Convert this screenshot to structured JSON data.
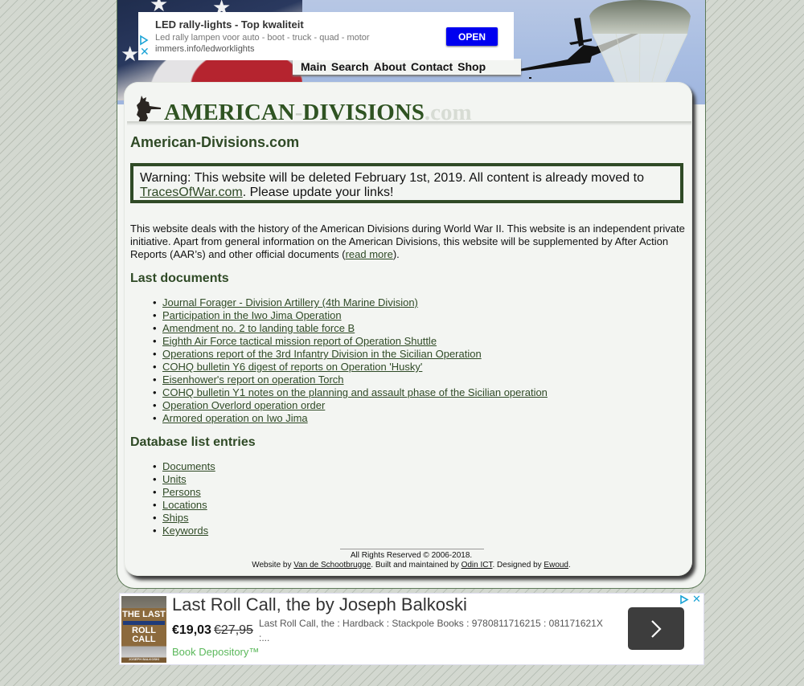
{
  "top_ad": {
    "title": "LED rally-lights - Top kwaliteit",
    "description": "Led rally lampen voor auto - boot - truck - quad - motor",
    "url": "immers.info/ledworklights",
    "button_label": "OPEN",
    "close_glyph": "✕",
    "button_color": "#0000f0"
  },
  "nav": {
    "items": [
      "Main",
      "Search",
      "About",
      "Contact",
      "Shop"
    ]
  },
  "logo": {
    "main": "AMERICAN",
    "dash": "-",
    "second": "DIVISIONS",
    "tld": ".com"
  },
  "site_title": "American-Divisions.com",
  "warning": {
    "text_before": "Warning: This website will be deleted February 1st, 2019. All content is already moved to ",
    "link": "TracesOfWar.com",
    "text_after": ". Please update your links!"
  },
  "intro": {
    "text": "This website deals with the history of the American Divisions during World War II. This website is an independent private initiative. Apart from general information on the American Divisions, this website will be supplemented by After Action Reports (AAR’s) and other official documents (",
    "link": "read more",
    "text_after": ")."
  },
  "last_documents": {
    "heading": "Last documents",
    "items": [
      "Journal Forager - Division Artillery (4th Marine Division)",
      "Participation in the Iwo Jima Operation",
      "Amendment no. 2 to landing table force B",
      "Eighth Air Force tactical mission report of Operation Shuttle",
      "Operations report of the 3rd Infantry Division in the Sicilian Operation",
      "COHQ bulletin Y6 digest of reports on Operation 'Husky'",
      "Eisenhower's report on operation Torch",
      "COHQ bulletin Y1 notes on the planning and assault phase of the Sicilian operation",
      "Operation Overlord operation order",
      "Armored operation on Iwo Jima"
    ]
  },
  "database": {
    "heading": "Database list entries",
    "items": [
      "Documents",
      "Units",
      "Persons",
      "Locations",
      "Ships",
      "Keywords"
    ]
  },
  "footer": {
    "rights": "All Rights Reserved © 2006-2018.",
    "website_by": "Website by ",
    "website_by_link": "Van de Schootbrugge",
    "built_by": ". Built and maintained by ",
    "built_by_link": "Odin ICT",
    "designed_by": ". Designed by ",
    "designed_by_link": "Ewoud",
    "end": "."
  },
  "bottom_ad": {
    "headline": "Last Roll Call, the by Joseph Balkoski",
    "price": "€19,03",
    "old_price": "€27,95",
    "description": "Last Roll Call, the : Hardback : Stackpole Books : 9780811716215 : 081171621X :...",
    "seller": "Book Depository™",
    "cover_line1": "THE LAST",
    "cover_line2": "ROLL CALL",
    "cover_author": "JOSEPH BALKOSKI",
    "close_glyph": "✕"
  },
  "colors": {
    "brand_green": "#2f4a26",
    "logo_green": "#2f5322",
    "panel_bg": "#f3f5f2"
  }
}
